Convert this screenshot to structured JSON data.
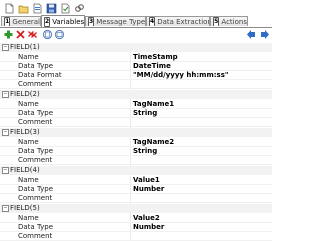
{
  "tabs": [
    {
      "num": "1",
      "label": "General"
    },
    {
      "num": "2",
      "label": "Variables"
    },
    {
      "num": "3",
      "label": "Message Types"
    },
    {
      "num": "4",
      "label": "Data Extraction"
    },
    {
      "num": "5",
      "label": "Actions"
    }
  ],
  "toolbar_icons": [
    "new-icon",
    "open-icon",
    "template-icon",
    "save-icon",
    "validate-icon",
    "link-icon"
  ],
  "action_icons": [
    "add-icon",
    "delete-icon",
    "delete-all-icon",
    "copy-icon",
    "paste-icon",
    "move-up-icon"
  ],
  "nav_icons": [
    "back-arrow-icon",
    "forward-arrow-icon"
  ],
  "fields": [
    {
      "name": "FIELD(1)",
      "props": [
        {
          "label": "Name",
          "value": "TimeStamp"
        },
        {
          "label": "Data Type",
          "value": "DateTime"
        },
        {
          "label": "Data Format",
          "value": "\"MM/dd/yyyy hh:mm:ss\""
        },
        {
          "label": "Comment",
          "value": ""
        }
      ]
    },
    {
      "name": "FIELD(2)",
      "props": [
        {
          "label": "Name",
          "value": "TagName1"
        },
        {
          "label": "Data Type",
          "value": "String"
        },
        {
          "label": "Comment",
          "value": ""
        }
      ]
    },
    {
      "name": "FIELD(3)",
      "props": [
        {
          "label": "Name",
          "value": "TagName2"
        },
        {
          "label": "Data Type",
          "value": "String"
        },
        {
          "label": "Comment",
          "value": ""
        }
      ]
    },
    {
      "name": "FIELD(4)",
      "props": [
        {
          "label": "Name",
          "value": "Value1"
        },
        {
          "label": "Data Type",
          "value": "Number"
        },
        {
          "label": "Comment",
          "value": ""
        }
      ]
    },
    {
      "name": "FIELD(5)",
      "props": [
        {
          "label": "Name",
          "value": "Value2"
        },
        {
          "label": "Data Type",
          "value": "Number"
        },
        {
          "label": "Comment",
          "value": ""
        }
      ]
    }
  ]
}
